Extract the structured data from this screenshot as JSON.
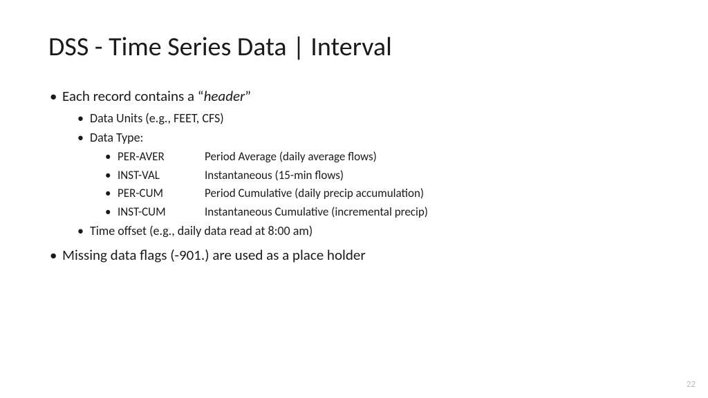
{
  "title": "DSS - Time Series Data | Interval",
  "bullets": {
    "b1_prefix": "Each record contains a “",
    "b1_italic": "header",
    "b1_suffix": "”",
    "b1_sub1": "Data Units (e.g., FEET, CFS)",
    "b1_sub2": "Data Type:",
    "types": [
      {
        "code": "PER-AVER",
        "desc": "Period Average (daily average flows)"
      },
      {
        "code": "INST-VAL",
        "desc": "Instantaneous (15-min flows)"
      },
      {
        "code": "PER-CUM",
        "desc": "Period Cumulative (daily precip accumulation)"
      },
      {
        "code": "INST-CUM",
        "desc": "Instantaneous Cumulative (incremental precip)"
      }
    ],
    "b1_sub3": "Time offset (e.g., daily data read at 8:00 am)",
    "b2": "Missing data flags (-901.) are used as a place holder"
  },
  "page_number": "22"
}
